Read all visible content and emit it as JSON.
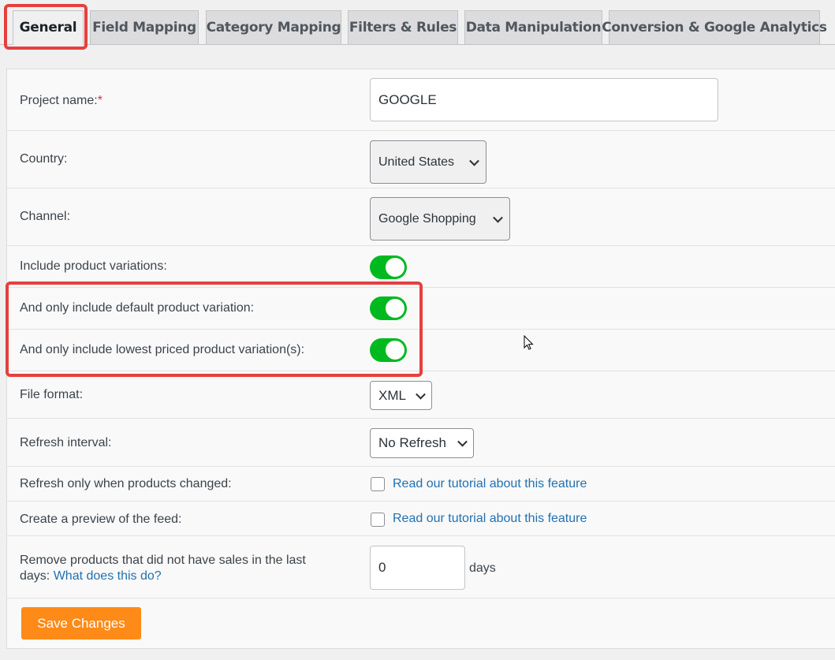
{
  "tabs": [
    {
      "label": "General",
      "active": true
    },
    {
      "label": "Field Mapping"
    },
    {
      "label": "Category Mapping"
    },
    {
      "label": "Filters & Rules"
    },
    {
      "label": "Data Manipulation"
    },
    {
      "label": "Conversion & Google Analytics"
    }
  ],
  "form": {
    "project_name": {
      "label": "Project name:",
      "required_mark": "*",
      "value": "GOOGLE"
    },
    "country": {
      "label": "Country:",
      "value": "United States"
    },
    "channel": {
      "label": "Channel:",
      "value": "Google Shopping"
    },
    "include_variations": {
      "label": "Include product variations:",
      "on": true
    },
    "default_variation": {
      "label": "And only include default product variation:",
      "on": true
    },
    "lowest_priced": {
      "label": "And only include lowest priced product variation(s):",
      "on": true
    },
    "file_format": {
      "label": "File format:",
      "value": "XML"
    },
    "refresh_interval": {
      "label": "Refresh interval:",
      "value": "No Refresh"
    },
    "refresh_changed": {
      "label": "Refresh only when products changed:",
      "checked": false,
      "link": "Read our tutorial about this feature"
    },
    "preview": {
      "label": "Create a preview of the feed:",
      "checked": false,
      "link": "Read our tutorial about this feature"
    },
    "remove_products": {
      "label": "Remove products that did not have sales in the last days:",
      "link": "What does this do?",
      "value": "0",
      "unit": "days"
    }
  },
  "save_label": "Save Changes",
  "colors": {
    "accent_toggle": "#00b91f",
    "save_button": "#fe8a17",
    "highlight": "#e5403f",
    "link": "#2271b1"
  }
}
